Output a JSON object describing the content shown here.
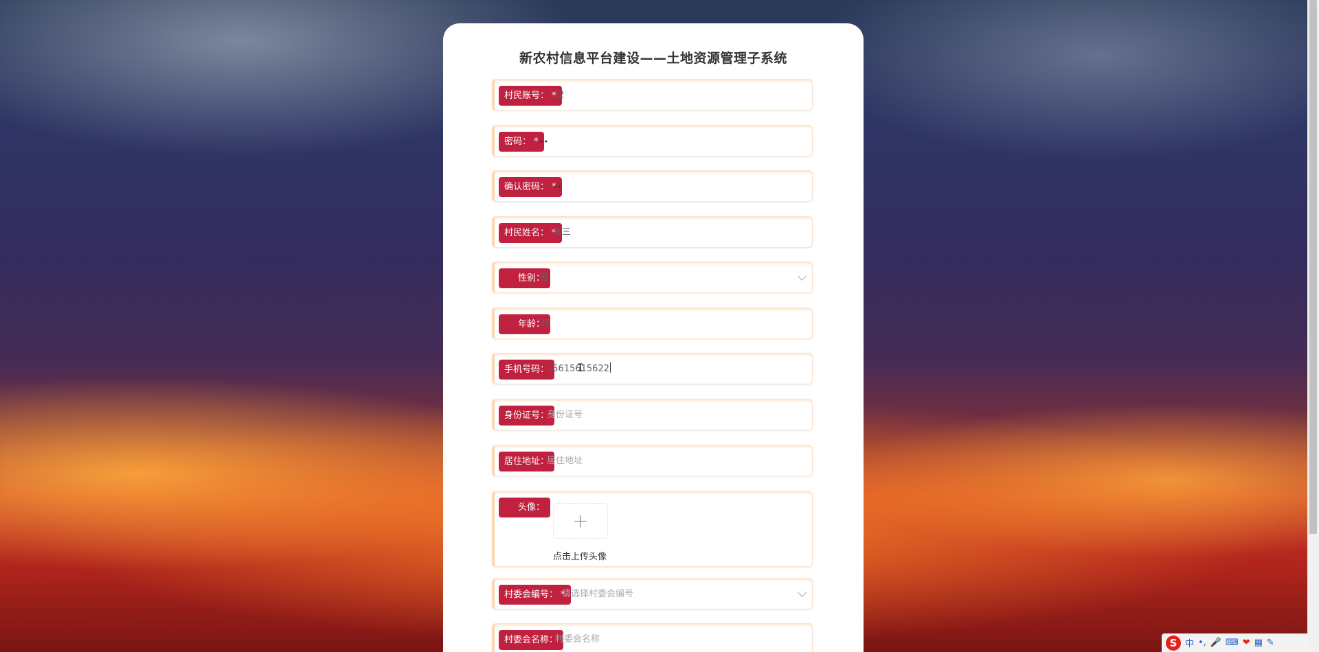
{
  "form": {
    "title": "新农村信息平台建设——土地资源管理子系统",
    "account": {
      "label": "村民账号：",
      "required": "*",
      "value": "22"
    },
    "password": {
      "label": "密码：",
      "required": "*",
      "value": "••"
    },
    "confirm_password": {
      "label": "确认密码：",
      "required": "*",
      "value": "••"
    },
    "name": {
      "label": "村民姓名：",
      "required": "*",
      "value": "张三"
    },
    "gender": {
      "label": "性别：",
      "value": "男"
    },
    "age": {
      "label": "年龄：",
      "value": "30"
    },
    "phone": {
      "label": "手机号码：",
      "value": "15615615622"
    },
    "id_card": {
      "label": "身份证号：",
      "placeholder": "身份证号"
    },
    "address": {
      "label": "居住地址：",
      "placeholder": "居住地址"
    },
    "avatar": {
      "label": "头像：",
      "plus": "+",
      "hint": "点击上传头像"
    },
    "committee_no": {
      "label": "村委会编号：",
      "required": "*",
      "placeholder": "请选择村委会编号"
    },
    "committee_name": {
      "label": "村委会名称：",
      "placeholder": "村委会名称"
    }
  },
  "ime": {
    "logo": "S",
    "mode": "中",
    "punct": "•,",
    "mic": "🎤",
    "keyboard": "⌨",
    "skin": "❤",
    "grid": "▦",
    "tools": "✎"
  },
  "colors": {
    "label_bg": "#c0213f",
    "accent_border": "#fcd8b6"
  }
}
